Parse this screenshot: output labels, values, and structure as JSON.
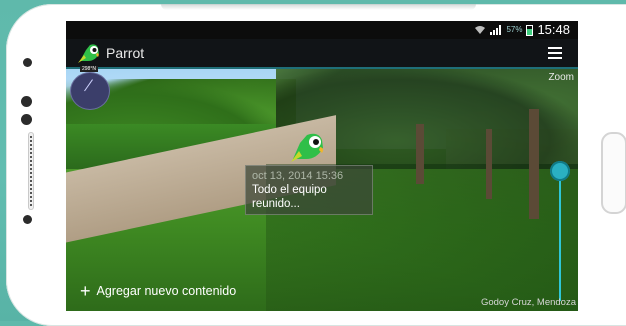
{
  "status_bar": {
    "battery_percent": "57%",
    "time": "15:48"
  },
  "app_bar": {
    "title": "Parrot"
  },
  "compass": {
    "label": "298°N"
  },
  "zoom": {
    "label": "Zoom",
    "level": 0.12
  },
  "post": {
    "date": "oct 13, 2014 15:36",
    "text_line1": "Todo el equipo",
    "text_line2": "reunido..."
  },
  "actions": {
    "add_label": "Agregar nuevo contenido",
    "add_icon": "+"
  },
  "location": "Godoy Cruz, Mendoza",
  "colors": {
    "accent": "#2ab0c2",
    "parrot_green": "#2fbf48"
  }
}
